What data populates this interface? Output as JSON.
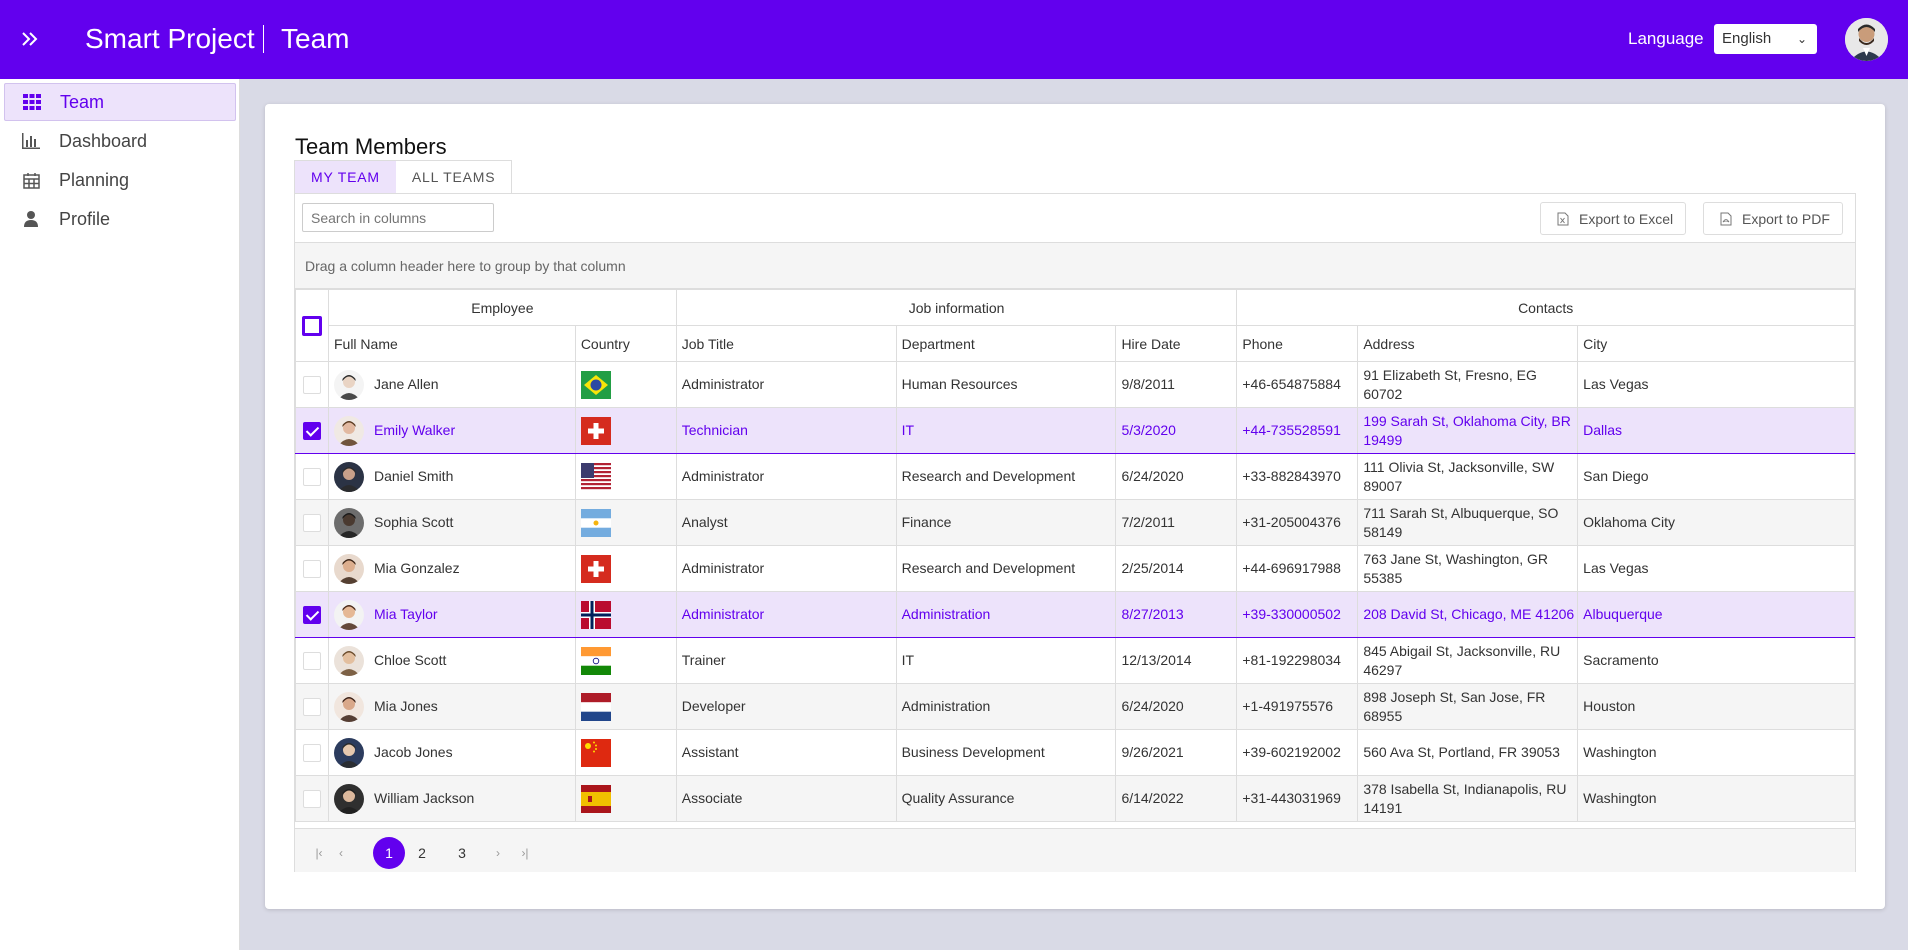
{
  "header": {
    "app_name": "Smart Project",
    "page_name": "Team",
    "language_label": "Language",
    "language_value": "English",
    "bg_color": "#6200ee"
  },
  "sidebar": {
    "items": [
      {
        "label": "Team",
        "icon": "grid-icon",
        "active": true
      },
      {
        "label": "Dashboard",
        "icon": "bar-chart-icon",
        "active": false
      },
      {
        "label": "Planning",
        "icon": "calendar-icon",
        "active": false
      },
      {
        "label": "Profile",
        "icon": "user-icon",
        "active": false
      }
    ]
  },
  "main": {
    "title": "Team Members",
    "tabs": [
      {
        "label": "MY TEAM",
        "active": true
      },
      {
        "label": "ALL TEAMS",
        "active": false
      }
    ],
    "search_placeholder": "Search in columns",
    "export_excel": "Export to Excel",
    "export_pdf": "Export to PDF",
    "group_panel_text": "Drag a column header here to group by that column",
    "bands": {
      "employee": "Employee",
      "job": "Job information",
      "contacts": "Contacts"
    },
    "columns": [
      "Full Name",
      "Country",
      "Job Title",
      "Department",
      "Hire Date",
      "Phone",
      "Address",
      "City"
    ],
    "rows": [
      {
        "name": "Jane Allen",
        "country": "brazil",
        "job": "Administrator",
        "dept": "Human Resources",
        "hire": "9/8/2011",
        "phone": "+46-654875884",
        "address": "91 Elizabeth St, Fresno, EG 60702",
        "city": "Las Vegas",
        "selected": false
      },
      {
        "name": "Emily Walker",
        "country": "switzerland",
        "job": "Technician",
        "dept": "IT",
        "hire": "5/3/2020",
        "phone": "+44-735528591",
        "address": "199 Sarah St, Oklahoma City, BR 19499",
        "city": "Dallas",
        "selected": true
      },
      {
        "name": "Daniel Smith",
        "country": "usa",
        "job": "Administrator",
        "dept": "Research and Development",
        "hire": "6/24/2020",
        "phone": "+33-882843970",
        "address": "111 Olivia St, Jacksonville, SW 89007",
        "city": "San Diego",
        "selected": false
      },
      {
        "name": "Sophia Scott",
        "country": "argentina",
        "job": "Analyst",
        "dept": "Finance",
        "hire": "7/2/2011",
        "phone": "+31-205004376",
        "address": "711 Sarah St, Albuquerque, SO 58149",
        "city": "Oklahoma City",
        "selected": false
      },
      {
        "name": "Mia Gonzalez",
        "country": "switzerland",
        "job": "Administrator",
        "dept": "Research and Development",
        "hire": "2/25/2014",
        "phone": "+44-696917988",
        "address": "763 Jane St, Washington, GR 55385",
        "city": "Las Vegas",
        "selected": false
      },
      {
        "name": "Mia Taylor",
        "country": "norway",
        "job": "Administrator",
        "dept": "Administration",
        "hire": "8/27/2013",
        "phone": "+39-330000502",
        "address": "208 David St, Chicago, ME 41206",
        "city": "Albuquerque",
        "selected": true
      },
      {
        "name": "Chloe Scott",
        "country": "india",
        "job": "Trainer",
        "dept": "IT",
        "hire": "12/13/2014",
        "phone": "+81-192298034",
        "address": "845 Abigail St, Jacksonville, RU 46297",
        "city": "Sacramento",
        "selected": false
      },
      {
        "name": "Mia Jones",
        "country": "netherlands",
        "job": "Developer",
        "dept": "Administration",
        "hire": "6/24/2020",
        "phone": "+1-491975576",
        "address": "898 Joseph St, San Jose, FR 68955",
        "city": "Houston",
        "selected": false
      },
      {
        "name": "Jacob Jones",
        "country": "china",
        "job": "Assistant",
        "dept": "Business Development",
        "hire": "9/26/2021",
        "phone": "+39-602192002",
        "address": "560 Ava St, Portland, FR 39053",
        "city": "Washington",
        "selected": false
      },
      {
        "name": "William Jackson",
        "country": "spain",
        "job": "Associate",
        "dept": "Quality Assurance",
        "hire": "6/14/2022",
        "phone": "+31-443031969",
        "address": "378 Isabella St, Indianapolis, RU 14191",
        "city": "Washington",
        "selected": false
      }
    ],
    "pager": {
      "pages": [
        "1",
        "2",
        "3"
      ],
      "current": "1"
    }
  }
}
